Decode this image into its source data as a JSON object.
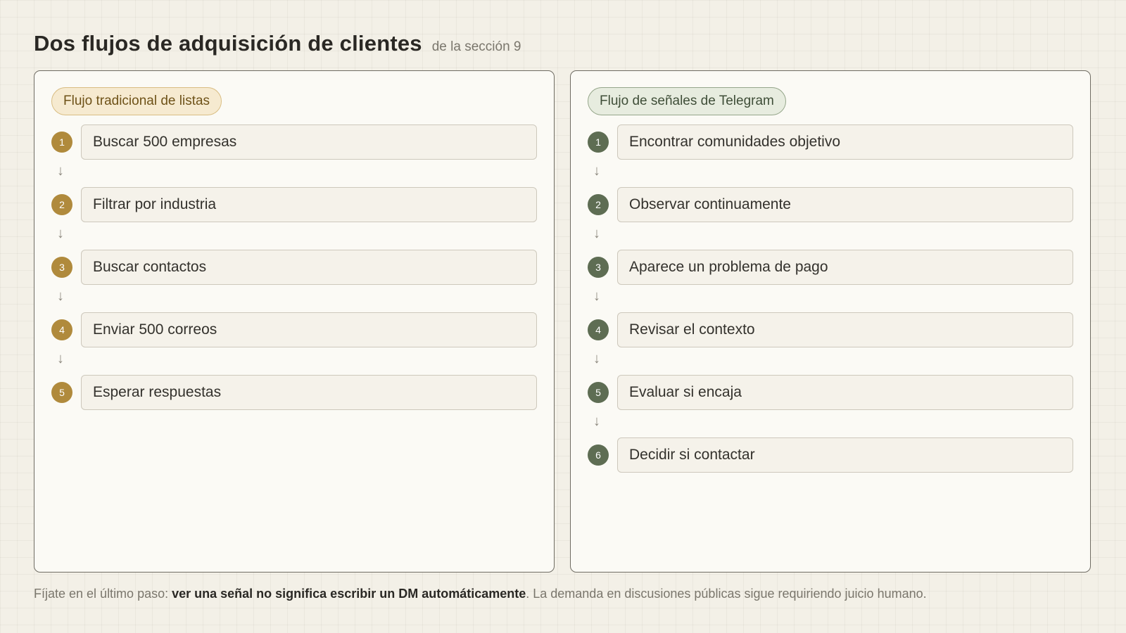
{
  "header": {
    "title": "Dos flujos de adquisición de clientes",
    "subtitle": "de la sección 9"
  },
  "left_panel": {
    "tag": "Flujo tradicional de listas",
    "accent": "#b08a3c",
    "steps": [
      {
        "num": "1",
        "label": "Buscar 500 empresas"
      },
      {
        "num": "2",
        "label": "Filtrar por industria"
      },
      {
        "num": "3",
        "label": "Buscar contactos"
      },
      {
        "num": "4",
        "label": "Enviar 500 correos"
      },
      {
        "num": "5",
        "label": "Esperar respuestas"
      }
    ]
  },
  "right_panel": {
    "tag": "Flujo de señales de Telegram",
    "accent": "#5e6d53",
    "steps": [
      {
        "num": "1",
        "label": "Encontrar comunidades objetivo"
      },
      {
        "num": "2",
        "label": "Observar continuamente"
      },
      {
        "num": "3",
        "label": "Aparece un problema de pago"
      },
      {
        "num": "4",
        "label": "Revisar el contexto"
      },
      {
        "num": "5",
        "label": "Evaluar si encaja"
      },
      {
        "num": "6",
        "label": "Decidir si contactar"
      }
    ]
  },
  "arrow_glyph": "↓",
  "footer": {
    "prefix": "Fíjate en el último paso: ",
    "emphasis": "ver una señal no significa escribir un DM automáticamente",
    "suffix": ". La demanda en discusiones públicas sigue requiriendo juicio humano."
  }
}
